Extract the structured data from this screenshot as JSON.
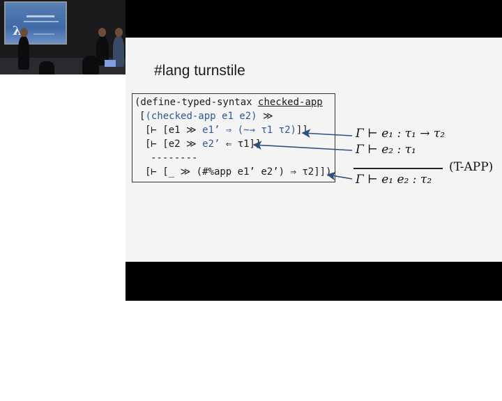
{
  "slide": {
    "title": "#lang turnstile",
    "code": {
      "line1_prefix": "(define-typed-syntax ",
      "line1_name": "checked-app",
      "line2_open": "[",
      "line2_pattern": "(checked-app e1 e2)",
      "line2_arrow": " ≫",
      "line3_start": "[⊢ [e1 ≫ ",
      "line3_blue": "e1’ ⇒ (~→ τ1 τ2)",
      "line3_end": "]]",
      "line4_start": "[⊢ [e2 ≫ ",
      "line4_blue": "e2’",
      "line4_end": " ⇐ τ1]]",
      "line5": "--------",
      "line6": "[⊢ [_ ≫ (#%app e1’ e2’) ⇒ τ2]])"
    },
    "math": {
      "premise1": "Γ ⊢ e₁ : τ₁ → τ₂",
      "premise2": "Γ ⊢ e₂ : τ₁",
      "conclusion": "Γ ⊢ e₁ e₂ : τ₂",
      "rule_name": "(T-APP)"
    }
  },
  "colors": {
    "code_blue": "#2d5a96",
    "slide_bg": "#f4f4f4",
    "letterbox": "#000000"
  }
}
